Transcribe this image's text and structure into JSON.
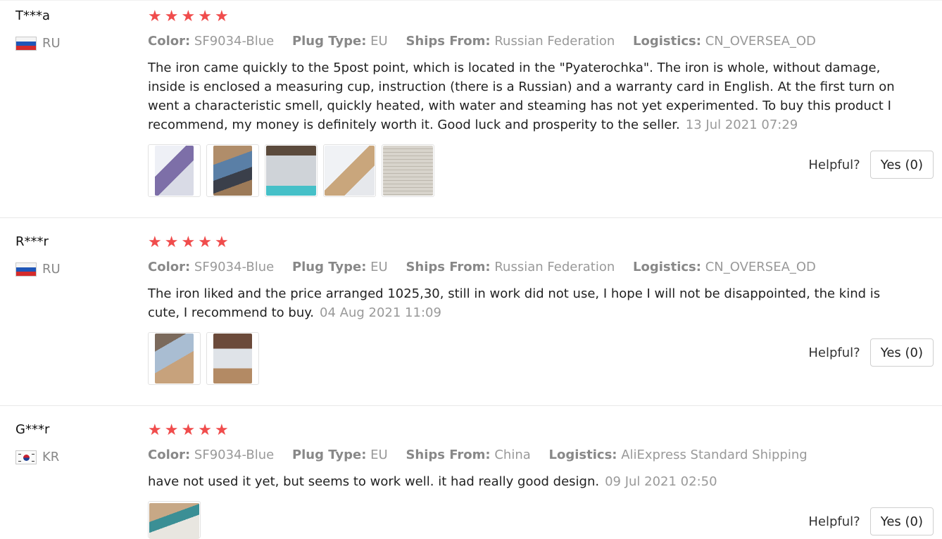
{
  "reviews": [
    {
      "user": "T***a",
      "country": "RU",
      "stars": 5,
      "sku": {
        "color_label": "Color:",
        "color": "SF9034-Blue",
        "plug_label": "Plug Type:",
        "plug": "EU",
        "ships_label": "Ships From:",
        "ships": "Russian Federation",
        "logistics_label": "Logistics:",
        "logistics": "CN_OVERSEA_OD"
      },
      "text": "The iron came quickly to the 5post point, which is located in the \"Pyaterochka\". The iron is whole, without damage, inside is enclosed a measuring cup, instruction (there is a Russian) and a warranty card in English. At the first turn on went a characteristic smell, quickly heated, with water and steaming has not yet experimented. To buy this product I recommend, my money is definitely worth it. Good luck and prosperity to the seller.",
      "date": "13 Jul 2021 07:29",
      "helpful_label": "Helpful?",
      "yes_label": "Yes (0)"
    },
    {
      "user": "R***r",
      "country": "RU",
      "stars": 5,
      "sku": {
        "color_label": "Color:",
        "color": "SF9034-Blue",
        "plug_label": "Plug Type:",
        "plug": "EU",
        "ships_label": "Ships From:",
        "ships": "Russian Federation",
        "logistics_label": "Logistics:",
        "logistics": "CN_OVERSEA_OD"
      },
      "text": "The iron liked and the price arranged 1025,30, still in work did not use, I hope I will not be disappointed, the kind is cute, I recommend to buy.",
      "date": "04 Aug 2021 11:09",
      "helpful_label": "Helpful?",
      "yes_label": "Yes (0)"
    },
    {
      "user": "G***r",
      "country": "KR",
      "stars": 5,
      "sku": {
        "color_label": "Color:",
        "color": "SF9034-Blue",
        "plug_label": "Plug Type:",
        "plug": "EU",
        "ships_label": "Ships From:",
        "ships": "China",
        "logistics_label": "Logistics:",
        "logistics": "AliExpress Standard Shipping"
      },
      "text": "have not used it yet, but seems to work well. it had really good design.",
      "date": "09 Jul 2021 02:50",
      "helpful_label": "Helpful?",
      "yes_label": "Yes (0)"
    }
  ],
  "colors": {
    "star": "#f04c4c",
    "meta": "#999999",
    "text": "#222222"
  }
}
